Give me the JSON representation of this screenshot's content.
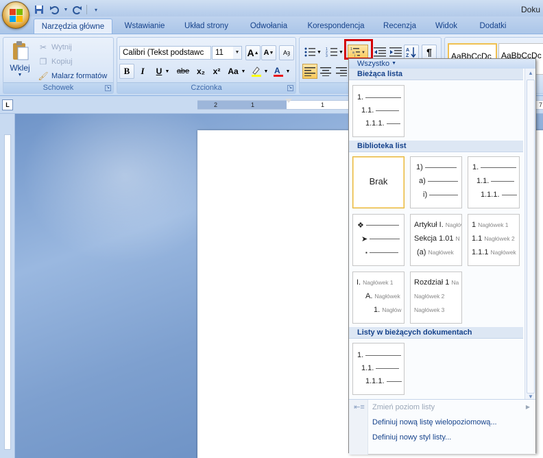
{
  "window": {
    "title": "Doku"
  },
  "qat": {
    "save_icon": "save-icon",
    "undo_icon": "undo-icon",
    "redo_icon": "redo-icon"
  },
  "tabs": [
    {
      "label": "Narzędzia główne",
      "active": true
    },
    {
      "label": "Wstawianie"
    },
    {
      "label": "Układ strony"
    },
    {
      "label": "Odwołania"
    },
    {
      "label": "Korespondencja"
    },
    {
      "label": "Recenzja"
    },
    {
      "label": "Widok"
    },
    {
      "label": "Dodatki"
    }
  ],
  "clipboard": {
    "paste_label": "Wklej",
    "cut_label": "Wytnij",
    "copy_label": "Kopiuj",
    "painter_label": "Malarz formatów",
    "group_label": "Schowek"
  },
  "font": {
    "family_value": "Calibri (Tekst podstawc",
    "size_value": "11",
    "group_label": "Czcionka",
    "bold": "B",
    "italic": "I",
    "underline": "U",
    "strike": "abe",
    "subscript": "x₂",
    "superscript": "x²",
    "case": "Aa",
    "grow": "A",
    "shrink": "A"
  },
  "styles": {
    "preview1": "AaBbCcDc",
    "preview2": "AaBbCcDc"
  },
  "ruler": {
    "numbers": [
      "2",
      "1",
      "1"
    ],
    "right_number": "7"
  },
  "dropdown": {
    "filter_label": "Wszystko",
    "sections": {
      "current": "Bieżąca lista",
      "library": "Biblioteka list",
      "documents": "Listy w bieżących dokumentach"
    },
    "tiles": {
      "brak": "Brak",
      "numbered": {
        "l1": "1.",
        "l2": "1.1.",
        "l3": "1.1.1."
      },
      "paren": {
        "l1": "1)",
        "l2": "a)",
        "l3": "i)"
      },
      "bullets": {
        "l1": "❖",
        "l2": "➤",
        "l3": "▪"
      },
      "article": {
        "l1": "Artykuł I.",
        "l1s": "Nagłówek",
        "l2": "Sekcja 1.01",
        "l2s": "N",
        "l3": "(a)",
        "l3s": "Nagłówek"
      },
      "heading_num": {
        "l1": "1",
        "l1s": "Nagłówek 1",
        "l2": "1.1",
        "l2s": "Nagłówek 2",
        "l3": "1.1.1",
        "l3s": "Nagłówek"
      },
      "roman": {
        "l1": "I.",
        "l1s": "Nagłówek 1",
        "l2": "A.",
        "l2s": "Nagłówek",
        "l3": "1.",
        "l3s": "Nagłów"
      },
      "chapter": {
        "l1": "Rozdział 1",
        "l1s": "Na",
        "l2s": "Nagłówek 2",
        "l3s": "Nagłówek 3"
      }
    },
    "menu": {
      "change_level": "Zmień poziom listy",
      "define_multilevel": "Definiuj nową listę wielopoziomową...",
      "define_style": "Definiuj nowy styl listy..."
    }
  }
}
